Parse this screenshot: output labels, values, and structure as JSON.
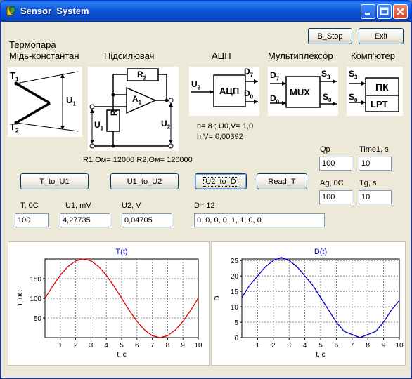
{
  "window": {
    "title": "Sensor_System"
  },
  "toolbar": {
    "b_stop_label": "B_Stop",
    "exit_label": "Exit"
  },
  "diagram": {
    "thermocouple_title_1": "Термопара",
    "thermocouple_title_2": "Мідь-константан",
    "amplifier_title": "Підсилювач",
    "adc_title": "АЦП",
    "mux_title": "Мультиплексор",
    "computer_title": "Комп'ютер",
    "t1": "T",
    "t1_sub": "1",
    "t2": "T",
    "t2_sub": "2",
    "u1": "U",
    "u1_sub": "1",
    "r2": "R",
    "r2_sub": "2",
    "a1": "A",
    "a1_sub": "1",
    "r1": "R",
    "r1_sub": "1",
    "u2": "U",
    "u2_sub": "2",
    "adc_in": "U",
    "adc_in_sub": "2",
    "adc_label": "АЦП",
    "d7": "D",
    "d7_sub": "7",
    "d0": "D",
    "d0_sub": "0",
    "mux_d7": "D",
    "mux_d7_sub": "7",
    "mux_d0": "D",
    "mux_d0_sub": "0",
    "mux_label": "MUX",
    "s3": "S",
    "s3_sub": "3",
    "s0": "S",
    "s0_sub": "0",
    "pc_s3": "S",
    "pc_s3_sub": "3",
    "pc_s0": "S",
    "pc_s0_sub": "0",
    "pc_label": "ПК",
    "lpt_label": "LPT"
  },
  "info": {
    "adc_params_1": "n= 8 ; U0,V= 1,0",
    "adc_params_2": "h,V= 0,00392",
    "resistors": "R1,Ом= 12000 R2,Ом= 120000"
  },
  "actions": {
    "t_to_u1": "T_to_U1",
    "u1_to_u2": "U1_to_U2",
    "u2_to_d": "U2_to_D",
    "read_t": "Read_T"
  },
  "params": {
    "qp_label": "Qp",
    "qp_value": "100",
    "time1_label": "Time1, s",
    "time1_value": "10",
    "ag_label": "Ag, 0C",
    "ag_value": "100",
    "tg_label": "Tg, s",
    "tg_value": "10"
  },
  "readings": {
    "t_label": "T, 0C",
    "t_value": "100",
    "u1_label": "U1, mV",
    "u1_value": "4,27735",
    "u2_label": "U2, V",
    "u2_value": "0,04705",
    "d_label": "D= 12",
    "d_value": "0, 0, 0, 0, 1, 1, 0, 0"
  },
  "colors": {
    "series_t": "#e00000",
    "series_d": "#0000c0",
    "title_blue": "#0000c0"
  },
  "chart_data": [
    {
      "type": "line",
      "title": "T(t)",
      "xlabel": "t, c",
      "ylabel": "T, 0C",
      "xlim": [
        0,
        10
      ],
      "ylim": [
        0,
        200
      ],
      "xticks": [
        1,
        2,
        3,
        4,
        5,
        6,
        7,
        8,
        9,
        10
      ],
      "yticks": [
        50,
        100,
        150
      ],
      "grid": true,
      "series": [
        {
          "x": [
            0,
            0.5,
            1,
            1.5,
            2,
            2.5,
            3,
            3.5,
            4,
            4.5,
            5,
            5.5,
            6,
            6.5,
            7,
            7.5,
            8,
            8.5,
            9,
            9.5,
            10
          ],
          "y": [
            100,
            130.9,
            158.8,
            180.9,
            195.1,
            200,
            195.1,
            180.9,
            158.8,
            130.9,
            100,
            69.1,
            41.2,
            19.1,
            4.9,
            0,
            4.9,
            19.1,
            41.2,
            69.1,
            100
          ]
        }
      ]
    },
    {
      "type": "line",
      "title": "D(t)",
      "xlabel": "t, c",
      "ylabel": "D",
      "xlim": [
        0,
        10
      ],
      "ylim": [
        0,
        25.5
      ],
      "xticks": [
        1,
        2,
        3,
        4,
        5,
        6,
        7,
        8,
        9,
        10
      ],
      "yticks": [
        0,
        5,
        10,
        15,
        20,
        25
      ],
      "grid": true,
      "series": [
        {
          "x": [
            0,
            0.5,
            1,
            1.5,
            2,
            2.5,
            3,
            3.5,
            4,
            4.5,
            5,
            5.5,
            6,
            6.5,
            7,
            7.5,
            8,
            8.5,
            9,
            9.5,
            10
          ],
          "y": [
            13,
            17,
            20,
            23,
            25,
            26,
            25,
            23,
            20,
            17,
            13,
            9,
            5,
            2,
            1,
            0,
            1,
            2,
            5,
            9,
            12
          ]
        }
      ]
    }
  ]
}
